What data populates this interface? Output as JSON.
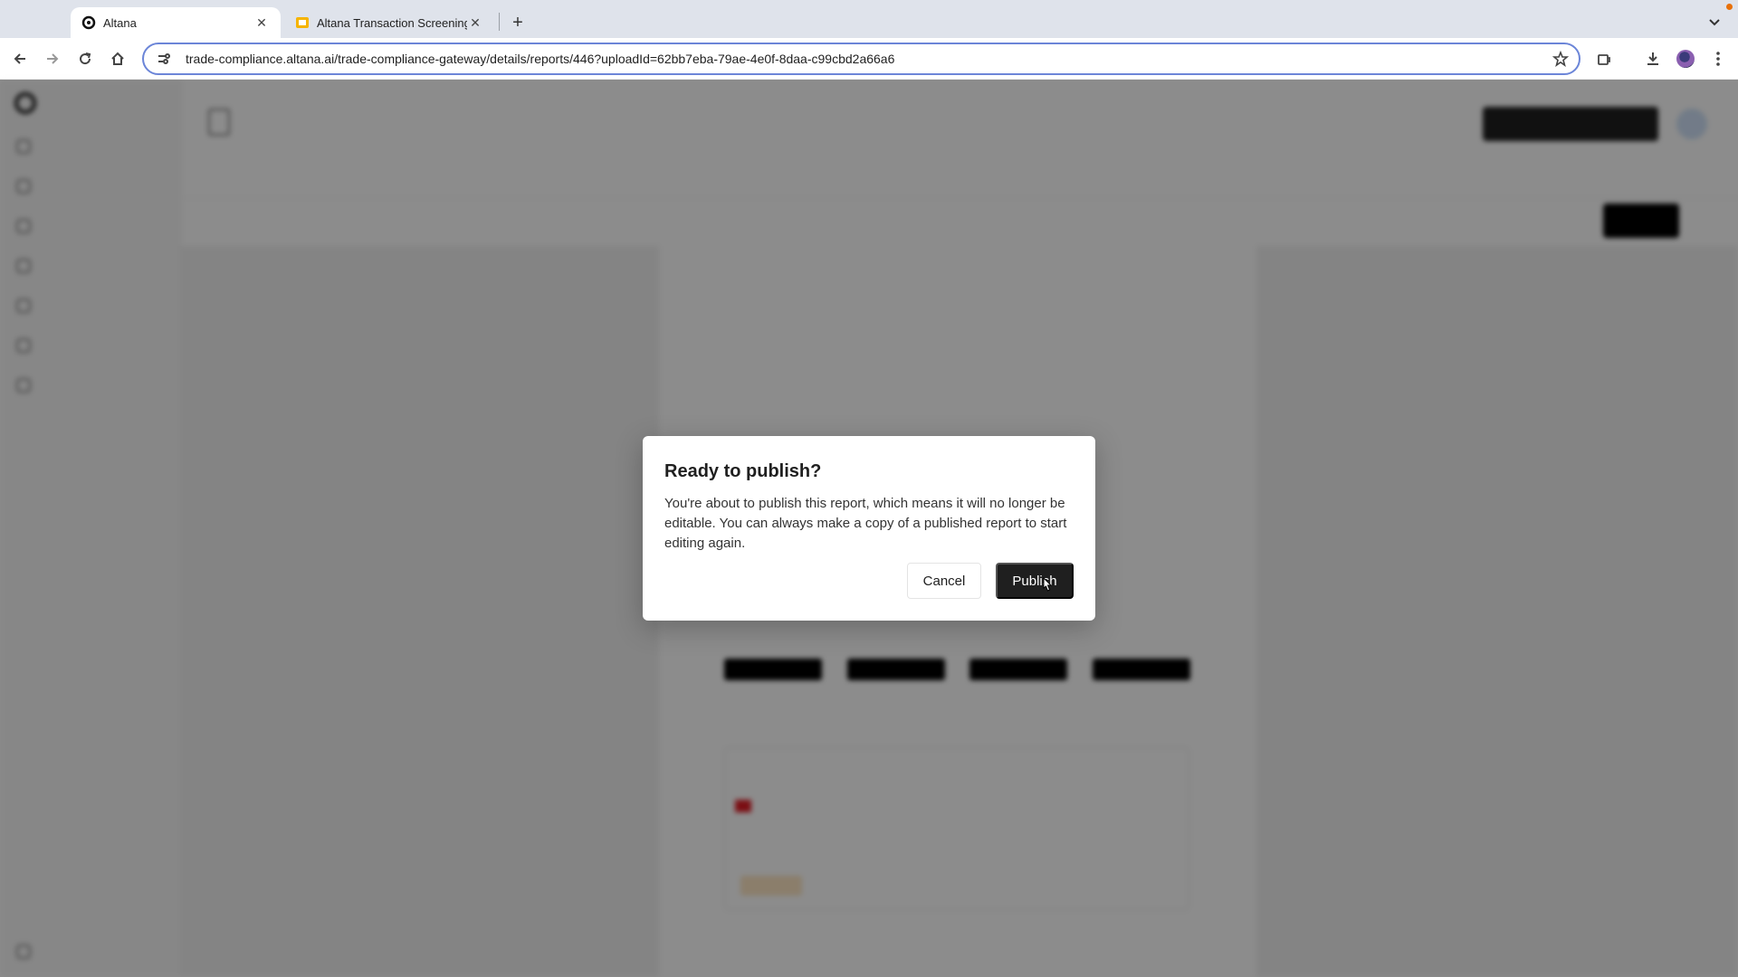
{
  "browser": {
    "tabs": [
      {
        "title": "Altana",
        "icon": "altana-logo-icon",
        "active": true
      },
      {
        "title": "Altana Transaction Screening",
        "icon": "slides-icon",
        "active": false
      }
    ],
    "url": "trade-compliance.altana.ai/trade-compliance-gateway/details/reports/446?uploadId=62bb7eba-79ae-4e0f-8daa-c99cbd2a66a6"
  },
  "modal": {
    "title": "Ready to publish?",
    "body": "You're about to publish this report, which means it will no longer be editable. You can always make a copy of a published report to start editing again.",
    "cancel_label": "Cancel",
    "publish_label": "Publish"
  },
  "colors": {
    "overlay": "#000000",
    "publish_button": "#1f1f1f",
    "omnibox_focus": "#6b85d8"
  }
}
